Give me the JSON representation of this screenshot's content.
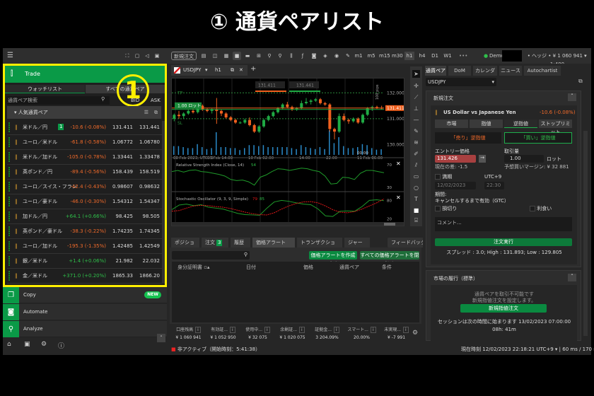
{
  "page_title": "① 通貨ペアリスト",
  "colors": {
    "brand_green": "#0a9a47",
    "highlight_border": "#ffef00",
    "negative": "#f06a2a",
    "positive": "#2fbf4a",
    "annotation_circle": "#ffef00"
  },
  "topbar": {
    "new_order": "新規注文",
    "timeframes": [
      "m1",
      "m5",
      "m15",
      "m30",
      "h1",
      "h4",
      "D1",
      "W1"
    ],
    "active_timeframe": "h1",
    "more": "•••",
    "account": "Demo •",
    "account_info": "• ヘッジ • ¥ 1 060 941 • 1:400"
  },
  "left": {
    "trade_label": "Trade",
    "annotation": "1",
    "tabs": [
      "ウォッチリスト",
      "すべての通貨ペア"
    ],
    "search_placeholder": "通貨ペア検索",
    "bid_header": "BID",
    "ask_header": "ASK",
    "group": "人気通貨ペア",
    "rows": [
      {
        "name": "米ドル／円",
        "badge": "1",
        "change": "-10.6 (-0.08%)",
        "dir": "neg",
        "bid": "131.411",
        "ask": "131.441"
      },
      {
        "name": "ユーロ／米ドル",
        "change": "-61.8 (-0.58%)",
        "dir": "neg",
        "bid": "1.06772",
        "ask": "1.06780"
      },
      {
        "name": "米ドル／加ドル",
        "change": "-105.0 (-0.78%)",
        "dir": "neg",
        "bid": "1.33441",
        "ask": "1.33478"
      },
      {
        "name": "英ポンド／円",
        "change": "-89.4 (-0.56%)",
        "dir": "neg",
        "bid": "158.439",
        "ask": "158.519"
      },
      {
        "name": "ユーロ／スイス・フラン",
        "change": "-42.4 (-0.43%)",
        "dir": "neg",
        "bid": "0.98607",
        "ask": "0.98632"
      },
      {
        "name": "ユーロ／豪ドル",
        "change": "-46.0 (-0.30%)",
        "dir": "neg",
        "bid": "1.54312",
        "ask": "1.54347"
      },
      {
        "name": "加ドル／円",
        "change": "+64.1 (+0.66%)",
        "dir": "pos",
        "bid": "98.425",
        "ask": "98.505"
      },
      {
        "name": "英ポンド／豪ドル",
        "change": "-38.3 (-0.22%)",
        "dir": "neg",
        "bid": "1.74235",
        "ask": "1.74345"
      },
      {
        "name": "ユーロ／加ドル",
        "change": "-195.3 (-1.35%)",
        "dir": "neg",
        "bid": "1.42485",
        "ask": "1.42549"
      },
      {
        "name": "銀／米ドル",
        "change": "+1.4 (+0.06%)",
        "dir": "pos",
        "bid": "21.982",
        "ask": "22.032"
      },
      {
        "name": "金／米ドル",
        "change": "+371.0 (+0.20%)",
        "dir": "pos",
        "bid": "1865.33",
        "ask": "1866.20"
      }
    ],
    "nav": [
      {
        "label": "Copy",
        "badge": "NEW",
        "icon": "copy-icon"
      },
      {
        "label": "Automate",
        "icon": "robot-icon"
      },
      {
        "label": "Analyze",
        "icon": "analyze-icon"
      }
    ]
  },
  "chart": {
    "tab_symbol": "USDJPY",
    "tab_tf": "h1",
    "bid_box": "131.411",
    "ask_box": "131.441",
    "position_label": "1.00 ロット",
    "tp": "TP",
    "sl": "SL",
    "current_price": "131.411",
    "pips_label": "100 pips",
    "crosshair_time": "00:00",
    "price_ticks": [
      "132.000",
      "131.000",
      "130.000"
    ],
    "time_ticks": [
      "08 Feb 2023, UTC+9",
      "09 Feb 14:00",
      "10 Feb 02:00",
      "14:00",
      "22:00",
      "11 Feb 06:00"
    ],
    "rsi_label": "Relative Strength Index (Close, 14)",
    "rsi_value": "54",
    "rsi_ticks": [
      "70",
      "30"
    ],
    "stoch_label": "Stochastic Oscillator (9, 3, 9, Simple)",
    "stoch_k": "79",
    "stoch_d": "85",
    "stoch_ticks": [
      "80",
      "20"
    ]
  },
  "chart_data": {
    "type": "candlestick",
    "ylim": [
      129.6,
      132.5
    ],
    "ohlc": [
      [
        131.0,
        131.2,
        130.9,
        131.15
      ],
      [
        131.15,
        131.3,
        131.0,
        131.1
      ],
      [
        131.1,
        131.25,
        131.0,
        131.2
      ],
      [
        131.2,
        131.35,
        131.15,
        131.3
      ],
      [
        131.3,
        131.4,
        131.2,
        131.25
      ],
      [
        131.25,
        131.6,
        131.2,
        131.5
      ],
      [
        131.5,
        131.55,
        131.3,
        131.35
      ],
      [
        131.35,
        131.4,
        131.25,
        131.3
      ],
      [
        131.3,
        131.4,
        131.2,
        131.35
      ],
      [
        131.35,
        131.8,
        130.8,
        131.3
      ],
      [
        131.3,
        131.35,
        131.1,
        131.2
      ],
      [
        131.2,
        131.25,
        131.0,
        131.05
      ],
      [
        131.05,
        131.1,
        130.9,
        130.95
      ],
      [
        130.95,
        131.0,
        130.8,
        130.85
      ],
      [
        130.85,
        130.9,
        130.8,
        130.85
      ],
      [
        130.85,
        131.0,
        130.8,
        130.95
      ],
      [
        130.95,
        131.05,
        130.7,
        130.75
      ],
      [
        130.75,
        130.8,
        130.45,
        130.5
      ],
      [
        130.5,
        130.75,
        130.45,
        130.7
      ],
      [
        130.7,
        131.0,
        130.65,
        130.95
      ],
      [
        130.95,
        131.15,
        130.9,
        131.1
      ],
      [
        131.1,
        131.3,
        131.05,
        131.25
      ],
      [
        131.25,
        131.45,
        131.2,
        131.4
      ],
      [
        131.4,
        131.6,
        131.35,
        131.55
      ],
      [
        131.55,
        131.65,
        131.4,
        131.45
      ],
      [
        131.45,
        131.5,
        131.3,
        131.35
      ],
      [
        131.35,
        131.45,
        131.3,
        131.4
      ],
      [
        131.4,
        131.7,
        131.35,
        131.6
      ],
      [
        131.6,
        131.8,
        131.55,
        131.65
      ],
      [
        131.65,
        131.75,
        131.55,
        131.7
      ],
      [
        131.7,
        131.8,
        131.65,
        131.75
      ],
      [
        131.75,
        131.8,
        131.55,
        131.6
      ],
      [
        131.6,
        131.65,
        131.5,
        131.55
      ],
      [
        131.55,
        131.6,
        130.5,
        130.6
      ],
      [
        130.6,
        130.65,
        130.2,
        130.5
      ],
      [
        130.5,
        131.2,
        130.45,
        131.1
      ],
      [
        131.1,
        131.2,
        130.9,
        130.95
      ],
      [
        130.95,
        131.0,
        130.8,
        130.9
      ],
      [
        130.9,
        131.05,
        130.85,
        131.0
      ],
      [
        131.0,
        131.05,
        130.8,
        130.85
      ],
      [
        130.85,
        131.2,
        130.8,
        131.15
      ],
      [
        131.15,
        131.45,
        131.1,
        131.4
      ],
      [
        131.4,
        131.5,
        131.3,
        131.45
      ],
      [
        131.45,
        131.5,
        131.38,
        131.42
      ],
      [
        131.42,
        131.5,
        131.36,
        131.41
      ]
    ],
    "rsi": [
      58,
      60,
      57,
      60,
      61,
      58,
      57,
      55,
      53,
      50,
      44,
      42,
      43,
      40,
      34,
      48,
      52,
      58,
      63,
      62,
      60,
      62,
      64,
      63,
      60,
      58,
      50,
      36,
      37,
      48,
      47,
      44,
      55,
      60,
      60,
      58,
      56
    ],
    "stoch_k": [
      50,
      65,
      68,
      63,
      66,
      58,
      55,
      52,
      45,
      38,
      34,
      33,
      32,
      55,
      75,
      80,
      77,
      72,
      68,
      66,
      52,
      30,
      28,
      45,
      46,
      45,
      60,
      80,
      82,
      79
    ],
    "stoch_d": [
      45,
      47,
      55,
      62,
      64,
      63,
      60,
      58,
      54,
      48,
      42,
      37,
      34,
      33,
      40,
      52,
      62,
      70,
      75,
      76,
      72,
      62,
      50,
      42,
      40,
      44,
      52,
      62,
      72,
      85
    ]
  },
  "bottom": {
    "tabs": [
      {
        "label": "ポジション",
        "badge": "1"
      },
      {
        "label": "注文",
        "badge": "3"
      },
      {
        "label": "履歴"
      },
      {
        "label": "価格アラート",
        "badge": "0"
      },
      {
        "label": "トランザクション（取引）"
      },
      {
        "label": "ジャーナ"
      }
    ],
    "feedback": "フィードバック",
    "create_alert": "価格アラートを作成する",
    "close_alerts": "すべての価格アラートを閉じる",
    "columns": [
      "身分証明書",
      "日付",
      "価格",
      "通貨ペア",
      "条件"
    ],
    "stats": [
      {
        "label": "口座残高",
        "value": "¥ 1 060 941"
      },
      {
        "label": "有効証...",
        "value": "¥ 1 052 950"
      },
      {
        "label": "使用中...",
        "value": "¥ 32 075"
      },
      {
        "label": "余剰証...",
        "value": "¥ 1 020 075"
      },
      {
        "label": "証拠金...",
        "value": "3 204.09%"
      },
      {
        "label": "スマート...",
        "value": "20.00%"
      },
      {
        "label": "未実現...",
        "value": "¥ -7 991",
        "neg": true
      }
    ],
    "status": "非アクティブ（開始時刻：5:41:38）"
  },
  "right": {
    "tabs": [
      "通貨ペア",
      "DoM",
      "カレンダー",
      "ニュース",
      "Autochartist"
    ],
    "symbol": "USDJPY",
    "section_title": "新規注文",
    "pair_name": "US Dollar vs Japanese Yen",
    "pair_change": "-10.6 (-0.08%)",
    "order_types": [
      "市場",
      "指値",
      "逆指値",
      "ストップリミット"
    ],
    "sell": "「売り」逆指値",
    "buy": "「買い」逆指値",
    "entry_label": "エントリー価格",
    "entry_value": "131.426",
    "distance": "現在の差: -1.5",
    "volume_label": "取引量",
    "volume_value": "1.00",
    "volume_unit": "ロット",
    "margin": "予想買いマージン: ¥ 32 881",
    "expiry": "満期",
    "tz": "UTC+9",
    "date": "12/02/2023",
    "time": "22:30",
    "period_label": "期間:",
    "period_value": "キャンセルするまで有効（GTC）",
    "sl": "損切り",
    "tp": "利食い",
    "comment_placeholder": "コメント...",
    "execute": "注文実行",
    "spread": "スプレッド : 3.0; High : 131.893; Low : 129.805",
    "market_title": "市場の履行（標準）",
    "market_msg1": "通貨ペアを取引不可能です",
    "market_msg2": "新規指値注文を設定します。",
    "new_limit": "新規指値注文",
    "session": "セッションは次の時間に始まります 13/02/2023 07:00:00",
    "countdown": "08h: 41m",
    "clock_label": "現在時刻",
    "clock": "12/02/2023 22:18:21",
    "clock_tz": "UTC+9",
    "latency": "| 60 ms / 170 ms"
  }
}
